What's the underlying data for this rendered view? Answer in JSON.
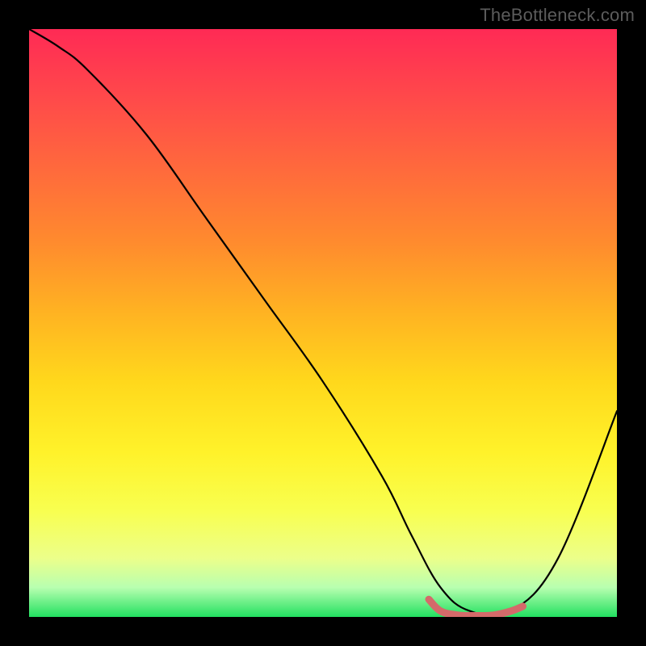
{
  "watermark": "TheBottleneck.com",
  "chart_data": {
    "type": "line",
    "title": "",
    "xlabel": "",
    "ylabel": "",
    "xlim": [
      0,
      100
    ],
    "ylim": [
      0,
      100
    ],
    "grid": false,
    "legend": false,
    "series": [
      {
        "name": "bottleneck-curve",
        "x": [
          0,
          5,
          10,
          20,
          30,
          40,
          50,
          60,
          65,
          70,
          75,
          82,
          90,
          100
        ],
        "values": [
          100,
          97,
          93,
          82,
          68,
          54,
          40,
          24,
          14,
          5,
          1,
          1,
          10,
          35
        ],
        "color": "#000000"
      },
      {
        "name": "optimal-segment",
        "x": [
          68,
          70,
          73,
          76,
          79,
          82,
          84
        ],
        "values": [
          3,
          1,
          0.3,
          0.2,
          0.3,
          1,
          1.8
        ],
        "color": "#d46a6a"
      }
    ],
    "annotations": []
  }
}
